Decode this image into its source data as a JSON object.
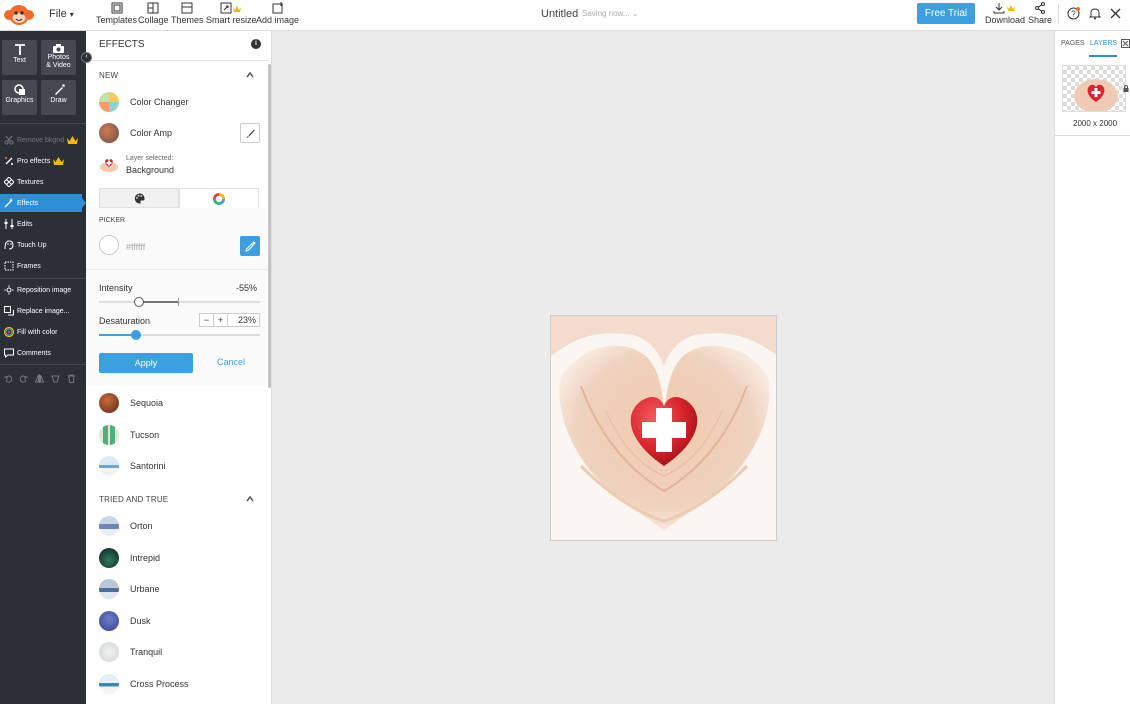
{
  "topbar": {
    "file_label": "File",
    "tools": [
      {
        "label": "Templates",
        "icon": "templates-icon"
      },
      {
        "label": "Collage",
        "icon": "collage-icon"
      },
      {
        "label": "Themes",
        "icon": "themes-icon"
      },
      {
        "label": "Smart resize",
        "icon": "smart-resize-icon"
      },
      {
        "label": "Add image",
        "icon": "add-image-icon"
      }
    ],
    "doc_title": "Untitled",
    "saving_text": "Saving now...",
    "free_trial": "Free Trial",
    "download": "Download",
    "share": "Share"
  },
  "left_toolbar": {
    "tiles": [
      {
        "label_line1": "Text",
        "label_line2": ""
      },
      {
        "label_line1": "Photos",
        "label_line2": "& Video"
      },
      {
        "label_line1": "Graphics",
        "label_line2": ""
      },
      {
        "label_line1": "Draw",
        "label_line2": ""
      }
    ],
    "items": [
      {
        "label": "Remove bkgnd",
        "icon": "scissors-icon"
      },
      {
        "label": "Pro effects",
        "icon": "pro-effects-icon"
      },
      {
        "label": "Textures",
        "icon": "textures-icon"
      },
      {
        "label": "Effects",
        "icon": "effects-icon"
      },
      {
        "label": "Edits",
        "icon": "edits-icon"
      },
      {
        "label": "Touch Up",
        "icon": "touch-up-icon"
      },
      {
        "label": "Frames",
        "icon": "frames-icon"
      },
      {
        "label": "Reposition image",
        "icon": "reposition-icon"
      },
      {
        "label": "Replace image...",
        "icon": "replace-image-icon"
      },
      {
        "label": "Fill with color",
        "icon": "fill-color-icon"
      },
      {
        "label": "Comments",
        "icon": "comments-icon"
      }
    ]
  },
  "effects_panel": {
    "title": "EFFECTS",
    "section_new": "NEW",
    "new_effects": [
      "Color Changer",
      "Color Amp"
    ],
    "layer_selected_label": "Layer selected:",
    "layer_selected_value": "Background",
    "picker_label": "PICKER",
    "picker_hex": "#ffffff",
    "intensity_label": "Intensity",
    "intensity_value": "-55%",
    "intensity_level": -0.55,
    "desaturation_label": "Desaturation",
    "desaturation_value": "23%",
    "desaturation_level": 0.23,
    "minus": "−",
    "plus": "+",
    "apply": "Apply",
    "cancel": "Cancel",
    "more_effects": [
      "Sequoia",
      "Tucson",
      "Santorini"
    ],
    "section_tried": "TRIED AND TRUE",
    "tried_effects": [
      "Orton",
      "Intrepid",
      "Urbane",
      "Dusk",
      "Tranquil",
      "Cross Process"
    ]
  },
  "right_panel": {
    "tab_pages": "PAGES",
    "tab_layers": "LAYERS",
    "page_size": "2000 x 2000"
  },
  "colors": {
    "accent": "#3b9fe0",
    "sidebar_bg": "#2b2f36",
    "active_item": "#2e8fd9",
    "crown": "#f5b700",
    "heart_red": "#d8242c"
  }
}
